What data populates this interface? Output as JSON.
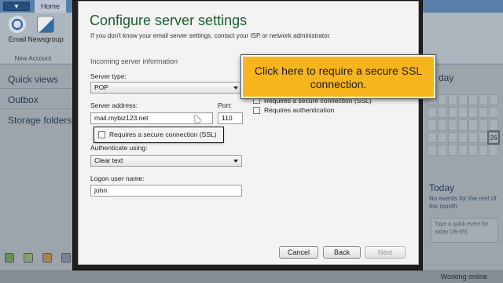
{
  "app": {
    "tab_home": "Home",
    "ribbon": {
      "email_label": "Email",
      "newsgroup_label": "Newsgroup",
      "group_label": "New Account"
    },
    "nav": {
      "items": [
        {
          "label": "Quick views"
        },
        {
          "label": "Outbox"
        },
        {
          "label": "Storage folders"
        }
      ]
    },
    "calendar": {
      "month_fragment": "day",
      "rows": [
        [
          "",
          "",
          "",
          "",
          "",
          "",
          ""
        ],
        [
          "",
          "",
          "",
          "",
          "",
          "",
          ""
        ],
        [
          "",
          "",
          "",
          "",
          "",
          "",
          ""
        ],
        [
          "",
          "",
          "",
          "",
          "",
          "",
          "26"
        ],
        [
          "",
          "",
          "",
          "",
          "",
          "",
          ""
        ]
      ],
      "today_title": "Today",
      "today_text": "No events for the rest of the month",
      "quick_event_placeholder": "Type a quick event for today (26-05)"
    },
    "status": "Working online"
  },
  "dialog": {
    "title": "Configure server settings",
    "subtitle": "If you don't know your email server settings, contact your ISP or network administrator.",
    "incoming_section": "Incoming server information",
    "server_type_label": "Server type:",
    "server_type_value": "POP",
    "server_address_label": "Server address:",
    "server_address_value": "mail.mybiz123.net",
    "port_label": "Port:",
    "port_value": "110",
    "ssl_label": "Requires a secure connection (SSL)",
    "ssl_label_outgoing": "Requires a secure connection (SSL)",
    "requires_auth_label": "Requires authentication",
    "authenticate_label": "Authenticate using:",
    "authenticate_value": "Clear text",
    "logon_label": "Logon user name:",
    "logon_value": "john",
    "buttons": {
      "cancel": "Cancel",
      "back": "Back",
      "next": "Next"
    }
  },
  "callout": {
    "text": "Click here to require a secure SSL connection."
  },
  "colors": {
    "callout_bg": "#f7b51d",
    "title_green": "#1a5e2a",
    "nav_text": "#1d3550"
  }
}
